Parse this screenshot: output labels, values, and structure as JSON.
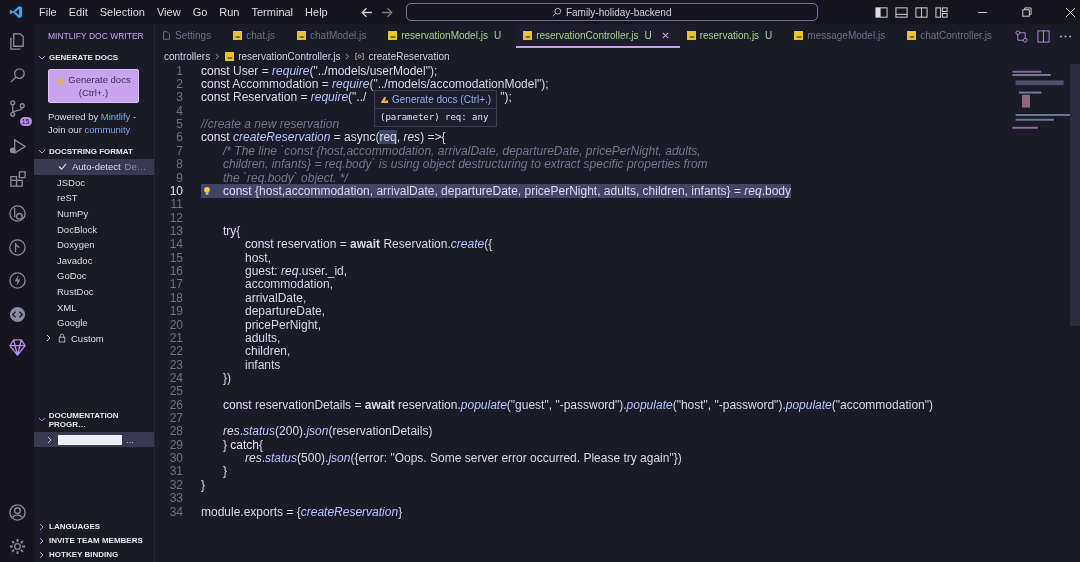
{
  "menu": [
    "File",
    "Edit",
    "Selection",
    "View",
    "Go",
    "Run",
    "Terminal",
    "Help"
  ],
  "command_center": "Family-holiday-backend",
  "activity_badge": "15",
  "sidebar": {
    "title": "MINTLIFY DOC WRITER",
    "generate": {
      "header": "GENERATE DOCS",
      "expanded": true,
      "button_line1": "Generate docs",
      "button_line2": "(Ctrl+.)",
      "powered": "Powered by",
      "powered_link": "Mintlify",
      "powered_dash": "-",
      "join": "Join our",
      "join_link": "community"
    },
    "format": {
      "header": "DOCSTRING FORMAT",
      "expanded": true,
      "items": [
        {
          "label": "Auto-detect",
          "description": "De…",
          "selected": true,
          "kind": "option"
        },
        {
          "label": "JSDoc",
          "selected": false,
          "kind": "option"
        },
        {
          "label": "reST",
          "selected": false,
          "kind": "option"
        },
        {
          "label": "NumPy",
          "selected": false,
          "kind": "option"
        },
        {
          "label": "DocBlock",
          "selected": false,
          "kind": "option"
        },
        {
          "label": "Doxygen",
          "selected": false,
          "kind": "option"
        },
        {
          "label": "Javadoc",
          "selected": false,
          "kind": "option"
        },
        {
          "label": "GoDoc",
          "selected": false,
          "kind": "option"
        },
        {
          "label": "RustDoc",
          "selected": false,
          "kind": "option"
        },
        {
          "label": "XML",
          "selected": false,
          "kind": "option"
        },
        {
          "label": "Google",
          "selected": false,
          "kind": "option"
        },
        {
          "label": "Custom",
          "selected": false,
          "kind": "locked"
        }
      ]
    },
    "progress": {
      "header": "DOCUMENTATION PROGR…",
      "expanded": true,
      "item_suffix": "..."
    },
    "bottom_sections": [
      {
        "header": "LANGUAGES",
        "expanded": false
      },
      {
        "header": "INVITE TEAM MEMBERS",
        "expanded": false
      },
      {
        "header": "HOTKEY BINDING",
        "expanded": false
      }
    ]
  },
  "tabs": [
    {
      "label": "Settings",
      "kind": "settings",
      "selected": false
    },
    {
      "label": "chat.js",
      "kind": "js",
      "selected": false
    },
    {
      "label": "chatModel.js",
      "kind": "js",
      "selected": false
    },
    {
      "label": "reservationModel.js",
      "kind": "js",
      "status": "U",
      "selected": false
    },
    {
      "label": "reservationController.js",
      "kind": "js",
      "status": "U",
      "selected": true
    },
    {
      "label": "reservation.js",
      "kind": "js",
      "status": "U",
      "selected": false
    },
    {
      "label": "messageModel.js",
      "kind": "js",
      "selected": false
    },
    {
      "label": "chatController.js",
      "kind": "js",
      "selected": false
    }
  ],
  "breadcrumb": [
    "controllers",
    "reservationController.js",
    "createReservation"
  ],
  "tooltip": {
    "action": "Generate docs (Ctrl+.)",
    "signature": "(parameter) req: any"
  },
  "code": [
    {
      "n": "1",
      "selected": false,
      "tokens": [
        {
          "kind": "kw",
          "text": "const"
        },
        {
          "kind": "plain",
          "text": " User = "
        },
        {
          "kind": "fn",
          "text": "require"
        },
        {
          "kind": "plain",
          "text": "(\"../models/userModel\");"
        }
      ]
    },
    {
      "n": "2",
      "selected": false,
      "tokens": [
        {
          "kind": "kw",
          "text": "const"
        },
        {
          "kind": "plain",
          "text": " Accommodation = "
        },
        {
          "kind": "fn",
          "text": "require"
        },
        {
          "kind": "plain",
          "text": "(\"../models/accomodationModel\");"
        }
      ]
    },
    {
      "n": "3",
      "selected": false,
      "tokens": [
        {
          "kind": "kw",
          "text": "const"
        },
        {
          "kind": "plain",
          "text": " Reservation = "
        },
        {
          "kind": "fn",
          "text": "require"
        },
        {
          "kind": "plain",
          "text": "(\"../"
        },
        {
          "kind": "covered"
        },
        {
          "kind": "plain",
          "text": "\");"
        }
      ]
    },
    {
      "n": "4",
      "selected": false
    },
    {
      "n": "5",
      "selected": false,
      "tokens": [
        {
          "kind": "comment",
          "text": "//create a new reservation"
        }
      ]
    },
    {
      "n": "6",
      "selected": false,
      "tokens": [
        {
          "kind": "kw",
          "text": "const "
        },
        {
          "kind": "fn",
          "text": "createReservation"
        },
        {
          "kind": "plain",
          "text": " = async("
        },
        {
          "kind": "hover",
          "text": "req"
        },
        {
          "kind": "plain",
          "text": ", "
        },
        {
          "kind": "param",
          "text": "res"
        },
        {
          "kind": "plain",
          "text": ") =>{"
        }
      ]
    },
    {
      "n": "7",
      "selected": false,
      "tokens": [
        {
          "kind": "comment",
          "text": "\t/* The line `const {host,accommodation, arrivalDate, departureDate, pricePerNight, adults,"
        }
      ]
    },
    {
      "n": "8",
      "selected": false,
      "tokens": [
        {
          "kind": "comment",
          "text": "\tchildren, infants} = req.body` is using object destructuring to extract specific properties from"
        }
      ]
    },
    {
      "n": "9",
      "selected": false,
      "tokens": [
        {
          "kind": "comment",
          "text": "\tthe `req.body` object. */"
        }
      ]
    },
    {
      "n": "10",
      "selected": true,
      "tokens": [
        {
          "kind": "kw",
          "text": "\tconst"
        },
        {
          "kind": "plain",
          "text": " {host,accommodation, arrivalDate, departureDate, pricePerNight, adults, children, infants} = "
        },
        {
          "kind": "param",
          "text": "req"
        },
        {
          "kind": "plain",
          "text": ".body"
        }
      ]
    },
    {
      "n": "11",
      "selected": false
    },
    {
      "n": "12",
      "selected": false
    },
    {
      "n": "13",
      "selected": false,
      "tokens": [
        {
          "kind": "kw",
          "text": "\ttry"
        },
        {
          "kind": "plain",
          "text": "{"
        }
      ]
    },
    {
      "n": "14",
      "selected": false,
      "tokens": [
        {
          "kind": "kw",
          "text": "\t\tconst"
        },
        {
          "kind": "plain",
          "text": " reservation = "
        },
        {
          "kind": "bold",
          "text": "await"
        },
        {
          "kind": "plain",
          "text": " Reservation."
        },
        {
          "kind": "fn",
          "text": "create"
        },
        {
          "kind": "plain",
          "text": "({"
        }
      ]
    },
    {
      "n": "15",
      "selected": false,
      "tokens": [
        {
          "kind": "plain",
          "text": "\t\thost,"
        }
      ]
    },
    {
      "n": "16",
      "selected": false,
      "tokens": [
        {
          "kind": "plain",
          "text": "\t\tguest: "
        },
        {
          "kind": "param",
          "text": "req"
        },
        {
          "kind": "plain",
          "text": ".user._id,"
        }
      ]
    },
    {
      "n": "17",
      "selected": false,
      "tokens": [
        {
          "kind": "plain",
          "text": "\t\taccommodation,"
        }
      ]
    },
    {
      "n": "18",
      "selected": false,
      "tokens": [
        {
          "kind": "plain",
          "text": "\t\tarrivalDate,"
        }
      ]
    },
    {
      "n": "19",
      "selected": false,
      "tokens": [
        {
          "kind": "plain",
          "text": "\t\tdepartureDate,"
        }
      ]
    },
    {
      "n": "20",
      "selected": false,
      "tokens": [
        {
          "kind": "plain",
          "text": "\t\tpricePerNight,"
        }
      ]
    },
    {
      "n": "21",
      "selected": false,
      "tokens": [
        {
          "kind": "plain",
          "text": "\t\tadults,"
        }
      ]
    },
    {
      "n": "22",
      "selected": false,
      "tokens": [
        {
          "kind": "plain",
          "text": "\t\tchildren,"
        }
      ]
    },
    {
      "n": "23",
      "selected": false,
      "tokens": [
        {
          "kind": "plain",
          "text": "\t\tinfants"
        }
      ]
    },
    {
      "n": "24",
      "selected": false,
      "tokens": [
        {
          "kind": "plain",
          "text": "\t})"
        }
      ]
    },
    {
      "n": "25",
      "selected": false
    },
    {
      "n": "26",
      "selected": false,
      "tokens": [
        {
          "kind": "kw",
          "text": "\tconst"
        },
        {
          "kind": "plain",
          "text": " reservationDetails = "
        },
        {
          "kind": "bold",
          "text": "await"
        },
        {
          "kind": "plain",
          "text": " reservation."
        },
        {
          "kind": "fn",
          "text": "populate"
        },
        {
          "kind": "plain",
          "text": "(\"guest\", \"-password\")."
        },
        {
          "kind": "fn",
          "text": "populate"
        },
        {
          "kind": "plain",
          "text": "(\"host\", \"-password\")."
        },
        {
          "kind": "fn",
          "text": "populate"
        },
        {
          "kind": "plain",
          "text": "(\"accommodation\")"
        }
      ]
    },
    {
      "n": "27",
      "selected": false
    },
    {
      "n": "28",
      "selected": false,
      "tokens": [
        {
          "kind": "param",
          "text": "\tres"
        },
        {
          "kind": "plain",
          "text": "."
        },
        {
          "kind": "fn",
          "text": "status"
        },
        {
          "kind": "plain",
          "text": "(200)."
        },
        {
          "kind": "fn",
          "text": "json"
        },
        {
          "kind": "plain",
          "text": "(reservationDetails)"
        }
      ]
    },
    {
      "n": "29",
      "selected": false,
      "tokens": [
        {
          "kind": "plain",
          "text": "\t} "
        },
        {
          "kind": "kw",
          "text": "catch"
        },
        {
          "kind": "plain",
          "text": "{"
        }
      ]
    },
    {
      "n": "30",
      "selected": false,
      "tokens": [
        {
          "kind": "param",
          "text": "\t\tres"
        },
        {
          "kind": "plain",
          "text": "."
        },
        {
          "kind": "fn",
          "text": "status"
        },
        {
          "kind": "plain",
          "text": "(500)."
        },
        {
          "kind": "fn",
          "text": "json"
        },
        {
          "kind": "plain",
          "text": "({error: \"Oops. Some server error occurred. Please try again\"})"
        }
      ]
    },
    {
      "n": "31",
      "selected": false,
      "tokens": [
        {
          "kind": "plain",
          "text": "\t}"
        }
      ]
    },
    {
      "n": "32",
      "selected": false,
      "tokens": [
        {
          "kind": "plain",
          "text": "}"
        }
      ]
    },
    {
      "n": "33",
      "selected": false
    },
    {
      "n": "34",
      "selected": false,
      "tokens": [
        {
          "kind": "plain",
          "text": "module.exports = {"
        },
        {
          "kind": "fn",
          "text": "createReservation"
        },
        {
          "kind": "plain",
          "text": "}"
        }
      ]
    }
  ]
}
